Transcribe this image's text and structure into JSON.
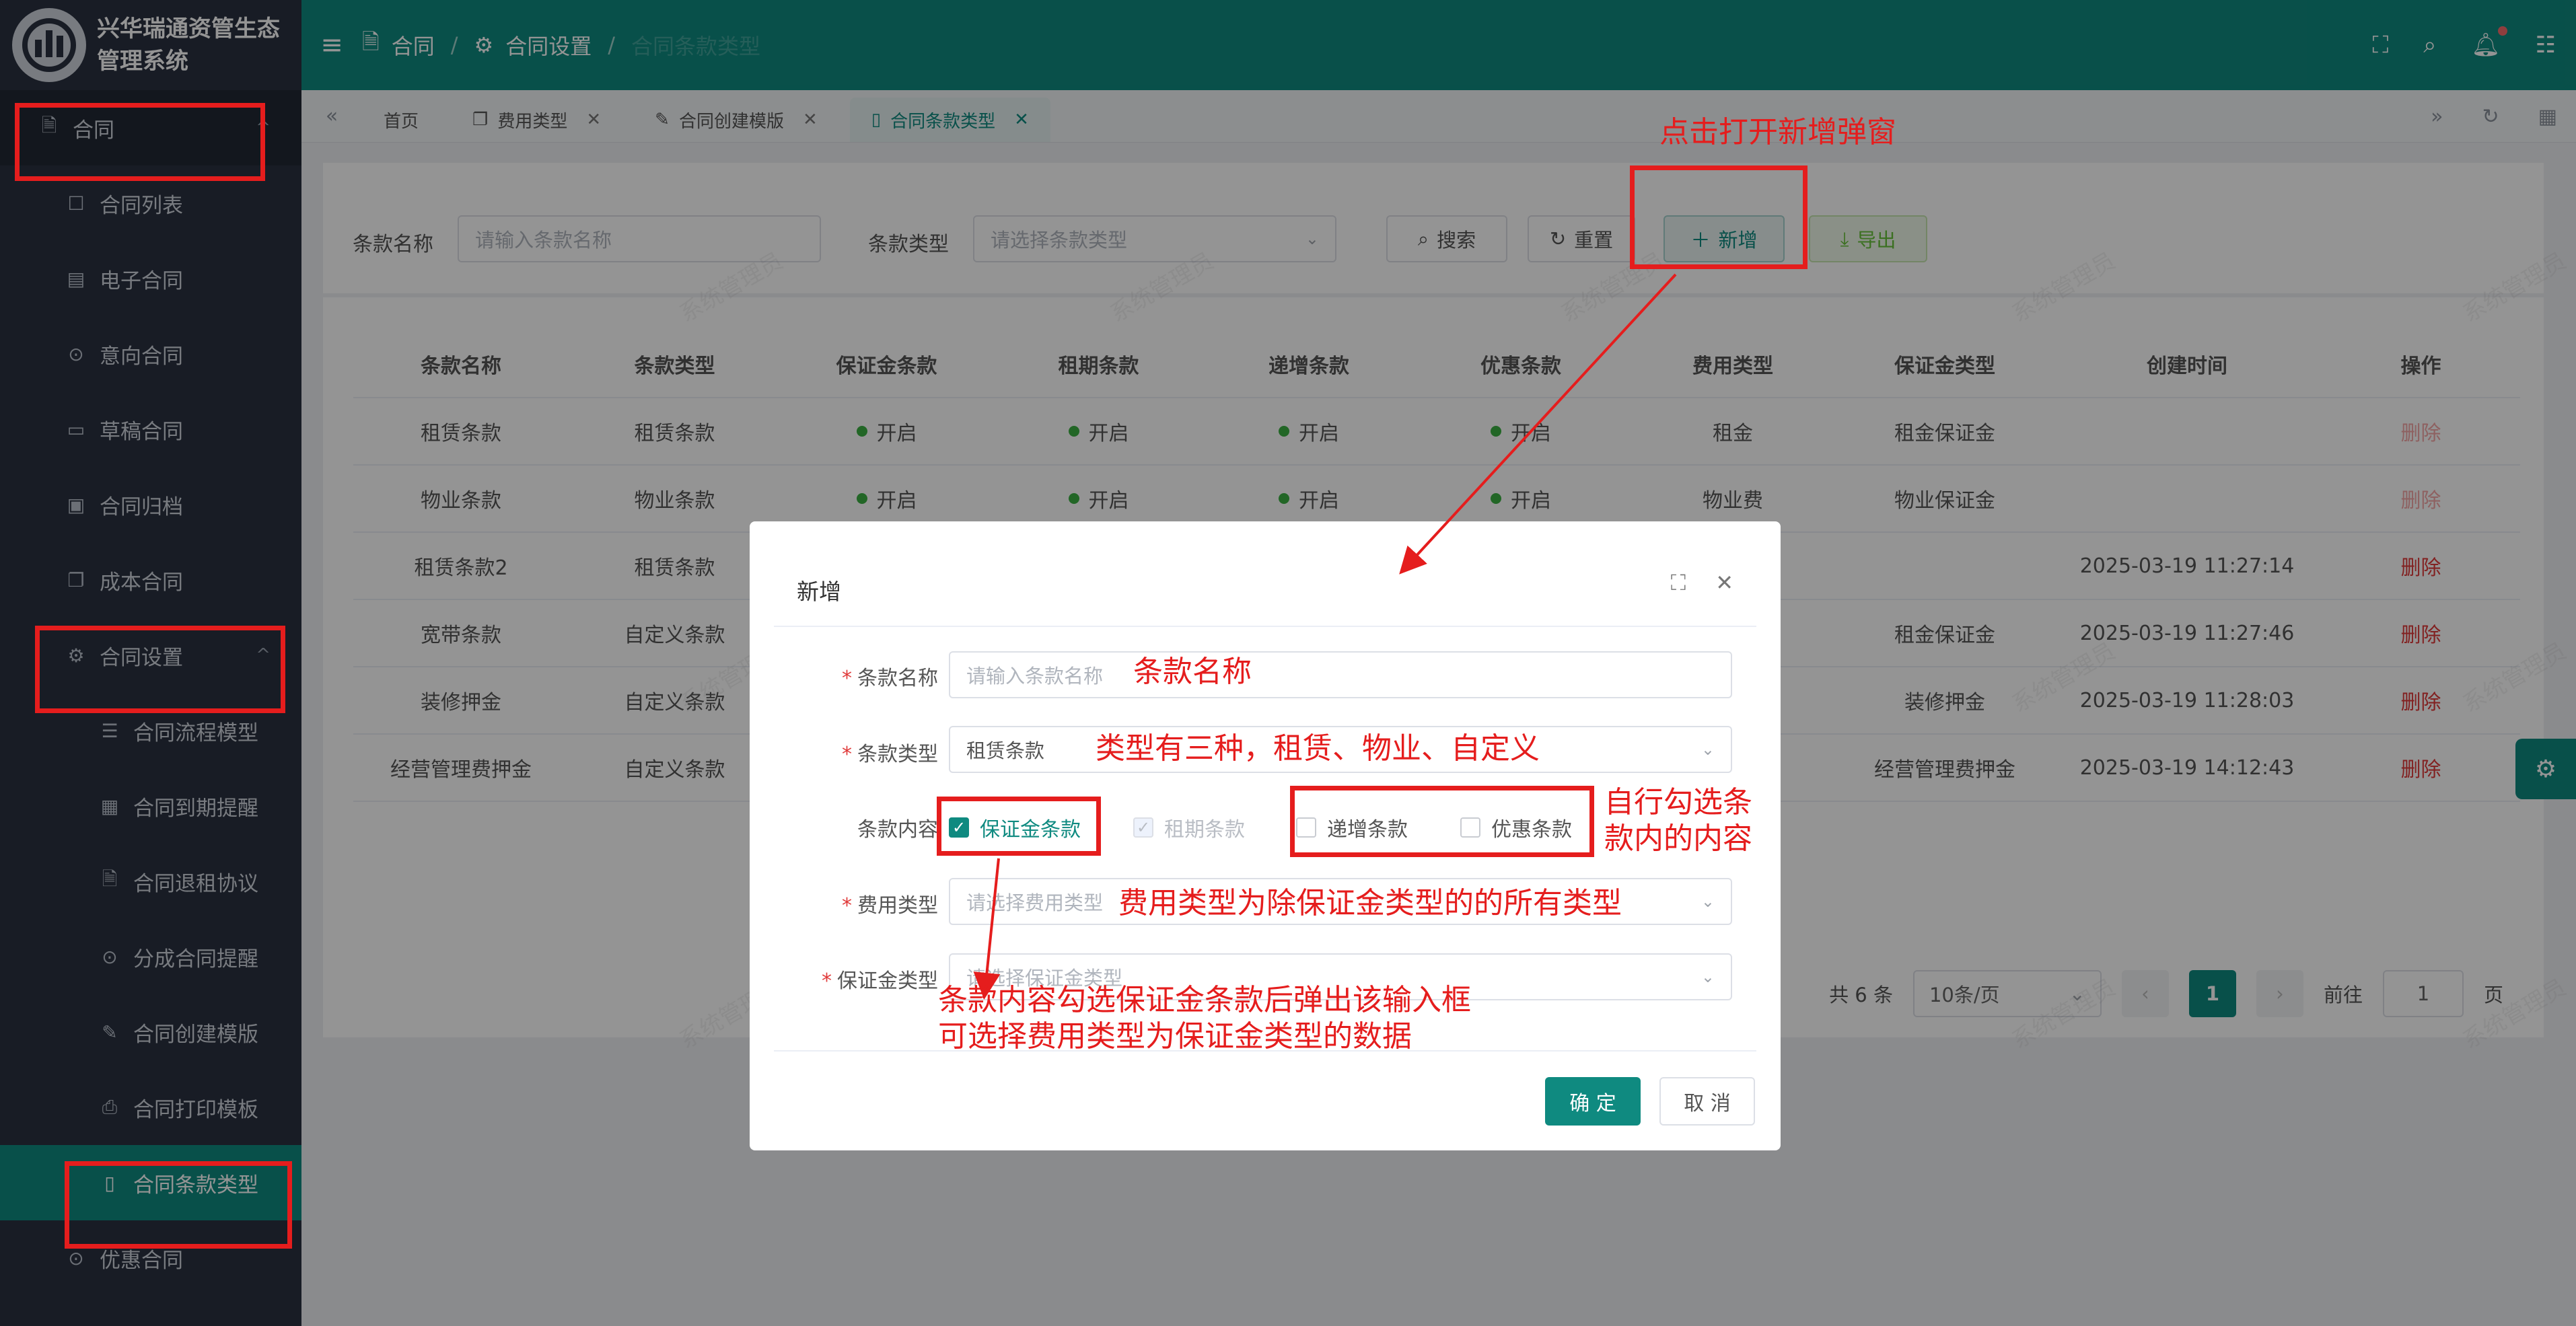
{
  "app": {
    "title_line1": "兴华瑞通资管生态",
    "title_line2": "管理系统"
  },
  "sidebar": {
    "items": [
      {
        "label": "合同",
        "icon": "document-icon",
        "level": "top"
      },
      {
        "label": "合同列表",
        "icon": "document-edit-icon",
        "level": "sub"
      },
      {
        "label": "电子合同",
        "icon": "save-icon",
        "level": "sub"
      },
      {
        "label": "意向合同",
        "icon": "location-icon",
        "level": "sub"
      },
      {
        "label": "草稿合同",
        "icon": "box-icon",
        "level": "sub"
      },
      {
        "label": "合同归档",
        "icon": "archive-icon",
        "level": "sub"
      },
      {
        "label": "成本合同",
        "icon": "copy-icon",
        "level": "sub"
      },
      {
        "label": "合同设置",
        "icon": "gear-icon",
        "level": "sub"
      },
      {
        "label": "合同流程模型",
        "icon": "sliders-icon",
        "level": "sub2"
      },
      {
        "label": "合同到期提醒",
        "icon": "calendar-icon",
        "level": "sub2"
      },
      {
        "label": "合同退租协议",
        "icon": "document-icon",
        "level": "sub2"
      },
      {
        "label": "分成合同提醒",
        "icon": "location-icon",
        "level": "sub2"
      },
      {
        "label": "合同创建模版",
        "icon": "edit-icon",
        "level": "sub2"
      },
      {
        "label": "合同打印模板",
        "icon": "printer-icon",
        "level": "sub2"
      },
      {
        "label": "合同条款类型",
        "icon": "tablet-icon",
        "level": "sub2"
      },
      {
        "label": "优惠合同",
        "icon": "location-icon",
        "level": "sub"
      }
    ]
  },
  "header": {
    "breadcrumb": [
      "合同",
      "合同设置",
      "合同条款类型"
    ]
  },
  "tabs": [
    {
      "label": "首页",
      "closable": false
    },
    {
      "label": "费用类型",
      "closable": true
    },
    {
      "label": "合同创建模版",
      "closable": true
    },
    {
      "label": "合同条款类型",
      "closable": true,
      "active": true
    }
  ],
  "search": {
    "name_label": "条款名称",
    "name_placeholder": "请输入条款名称",
    "type_label": "条款类型",
    "type_placeholder": "请选择条款类型",
    "search_btn": "搜索",
    "reset_btn": "重置",
    "add_btn": "新增",
    "export_btn": "导出"
  },
  "table": {
    "columns": [
      "条款名称",
      "条款类型",
      "保证金条款",
      "租期条款",
      "递增条款",
      "优惠条款",
      "费用类型",
      "保证金类型",
      "创建时间",
      "操作"
    ],
    "rows": [
      [
        "租赁条款",
        "租赁条款",
        "开启",
        "开启",
        "开启",
        "开启",
        "租金",
        "租金保证金",
        "",
        "删除"
      ],
      [
        "物业条款",
        "物业条款",
        "开启",
        "开启",
        "开启",
        "开启",
        "物业费",
        "物业保证金",
        "",
        "删除"
      ],
      [
        "租赁条款2",
        "租赁条款",
        "",
        "",
        "",
        "",
        "",
        "",
        "2025-03-19 11:27:14",
        "删除"
      ],
      [
        "宽带条款",
        "自定义条款",
        "",
        "",
        "",
        "",
        "",
        "租金保证金",
        "2025-03-19 11:27:46",
        "删除"
      ],
      [
        "装修押金",
        "自定义条款",
        "",
        "",
        "",
        "",
        "",
        "装修押金",
        "2025-03-19 11:28:03",
        "删除"
      ],
      [
        "经营管理费押金",
        "自定义条款",
        "",
        "",
        "",
        "",
        "",
        "经营管理费押金",
        "2025-03-19 14:12:43",
        "删除"
      ]
    ]
  },
  "pager": {
    "total": "共 6 条",
    "size": "10条/页",
    "current": "1",
    "goto_label": "前往",
    "goto_value": "1",
    "page_suffix": "页"
  },
  "watermark": "系统管理员",
  "dialog": {
    "title": "新增",
    "name_label": "条款名称",
    "name_placeholder": "请输入条款名称",
    "type_label": "条款类型",
    "type_value": "租赁条款",
    "content_label": "条款内容",
    "checks": [
      {
        "label": "保证金条款",
        "state": "checked"
      },
      {
        "label": "租期条款",
        "state": "checked-disabled"
      },
      {
        "label": "递增条款",
        "state": "unchecked"
      },
      {
        "label": "优惠条款",
        "state": "unchecked"
      }
    ],
    "fee_label": "费用类型",
    "fee_placeholder": "请选择费用类型",
    "deposit_label": "保证金类型",
    "deposit_placeholder": "请选择保证金类型",
    "ok": "确 定",
    "cancel": "取 消"
  },
  "annotations": {
    "open_dialog": "点击打开新增弹窗",
    "name": "条款名称",
    "type": "类型有三种，租赁、物业、自定义",
    "self_check_1": "自行勾选条",
    "self_check_2": "款内的内容",
    "fee": "费用类型为除保证金类型的的所有类型",
    "deposit_1": "条款内容勾选保证金条款后弹出该输入框",
    "deposit_2": "可选择费用类型为保证金类型的数据"
  },
  "colors": {
    "primary": "#0f8a80",
    "sidebar": "#2a3140",
    "danger": "#e03a3a",
    "annotation": "#e51d1d"
  }
}
